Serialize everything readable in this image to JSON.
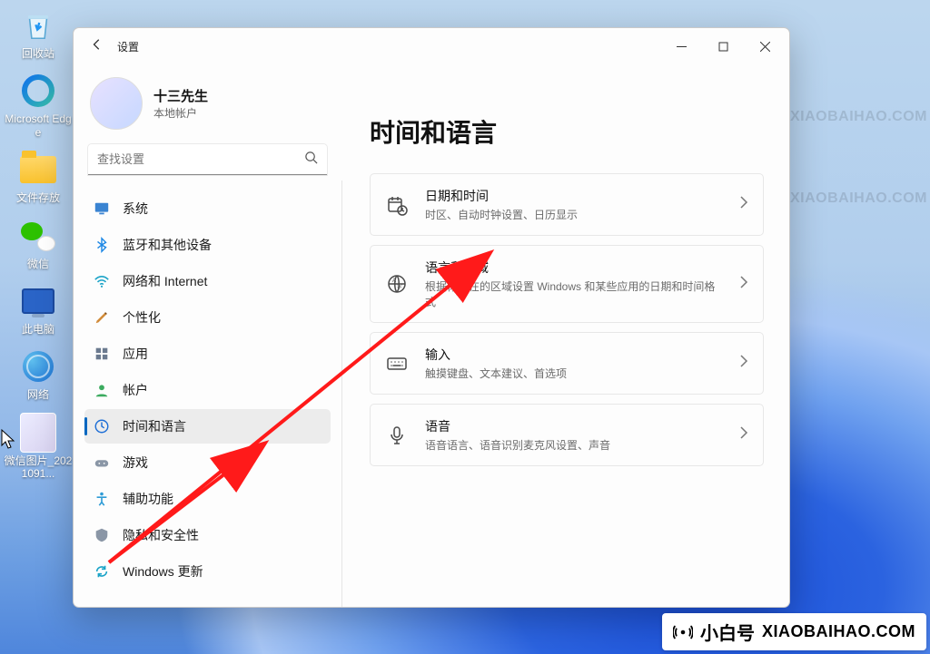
{
  "desktop": {
    "icons": [
      {
        "name": "recycle-bin",
        "label": "回收站"
      },
      {
        "name": "microsoft-edge",
        "label": "Microsoft Edge"
      },
      {
        "name": "folder-files",
        "label": "文件存放"
      },
      {
        "name": "wechat",
        "label": "微信"
      },
      {
        "name": "this-pc",
        "label": "此电脑"
      },
      {
        "name": "network",
        "label": "网络"
      },
      {
        "name": "wechat-image",
        "label": "微信图片_2021091..."
      }
    ]
  },
  "window": {
    "title": "设置",
    "user": {
      "name": "十三先生",
      "account_type": "本地帐户"
    },
    "search_placeholder": "查找设置",
    "nav": [
      {
        "key": "system",
        "label": "系统"
      },
      {
        "key": "bluetooth",
        "label": "蓝牙和其他设备"
      },
      {
        "key": "network",
        "label": "网络和 Internet"
      },
      {
        "key": "personalization",
        "label": "个性化"
      },
      {
        "key": "apps",
        "label": "应用"
      },
      {
        "key": "accounts",
        "label": "帐户"
      },
      {
        "key": "time-language",
        "label": "时间和语言",
        "selected": true
      },
      {
        "key": "gaming",
        "label": "游戏"
      },
      {
        "key": "accessibility",
        "label": "辅助功能"
      },
      {
        "key": "privacy",
        "label": "隐私和安全性"
      },
      {
        "key": "windows-update",
        "label": "Windows 更新"
      }
    ],
    "page_title": "时间和语言",
    "cards": [
      {
        "key": "date-time",
        "title": "日期和时间",
        "sub": "时区、自动时钟设置、日历显示"
      },
      {
        "key": "lang-region",
        "title": "语言和区域",
        "sub": "根据你所在的区域设置 Windows 和某些应用的日期和时间格式"
      },
      {
        "key": "input",
        "title": "输入",
        "sub": "触摸键盘、文本建议、首选项"
      },
      {
        "key": "speech",
        "title": "语音",
        "sub": "语音语言、语音识别麦克风设置、声音"
      }
    ]
  },
  "watermark": {
    "cn": "小白号",
    "en": "XIAOBAIHAO.COM"
  },
  "badge": {
    "cn": "小白号",
    "en": "XIAOBAIHAO.COM"
  }
}
